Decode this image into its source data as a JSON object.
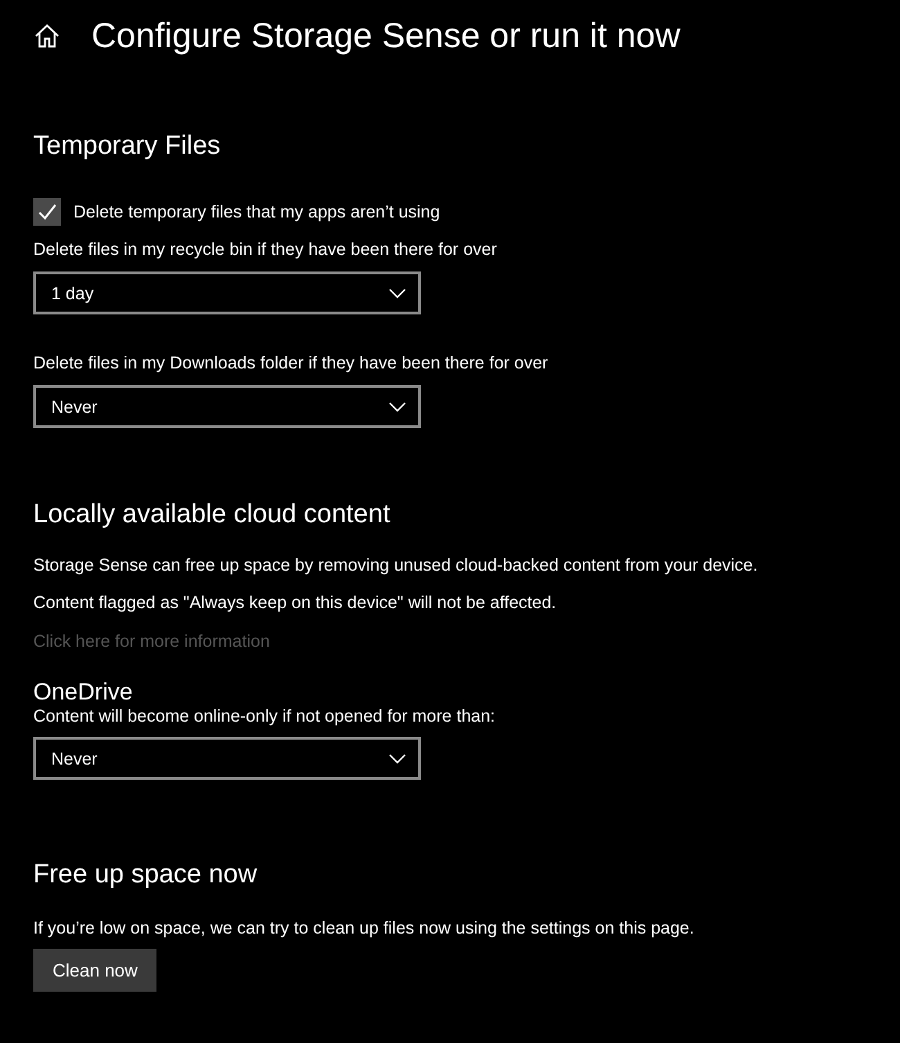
{
  "header": {
    "title": "Configure Storage Sense or run it now"
  },
  "temporary_files": {
    "heading": "Temporary Files",
    "checkbox": {
      "label": "Delete temporary files that my apps aren’t using",
      "checked": true
    },
    "dropdowns": [
      {
        "label": "Delete files in my recycle bin if they have been there for over",
        "value": "1 day"
      },
      {
        "label": "Delete files in my Downloads folder if they have been there for over",
        "value": "Never"
      }
    ]
  },
  "cloud_content": {
    "heading": "Locally available cloud content",
    "paragraphs": [
      "Storage Sense can free up space by removing unused cloud-backed content from your device.",
      "Content flagged as \"Always keep on this device\" will not be affected."
    ],
    "link": "Click here for more information",
    "onedrive": {
      "heading": "OneDrive",
      "label": "Content will become online-only if not opened for more than:",
      "value": "Never"
    }
  },
  "free_up": {
    "heading": "Free up space now",
    "description": "If you’re low on space, we can try to clean up files now using the settings on this page.",
    "button": "Clean now"
  }
}
